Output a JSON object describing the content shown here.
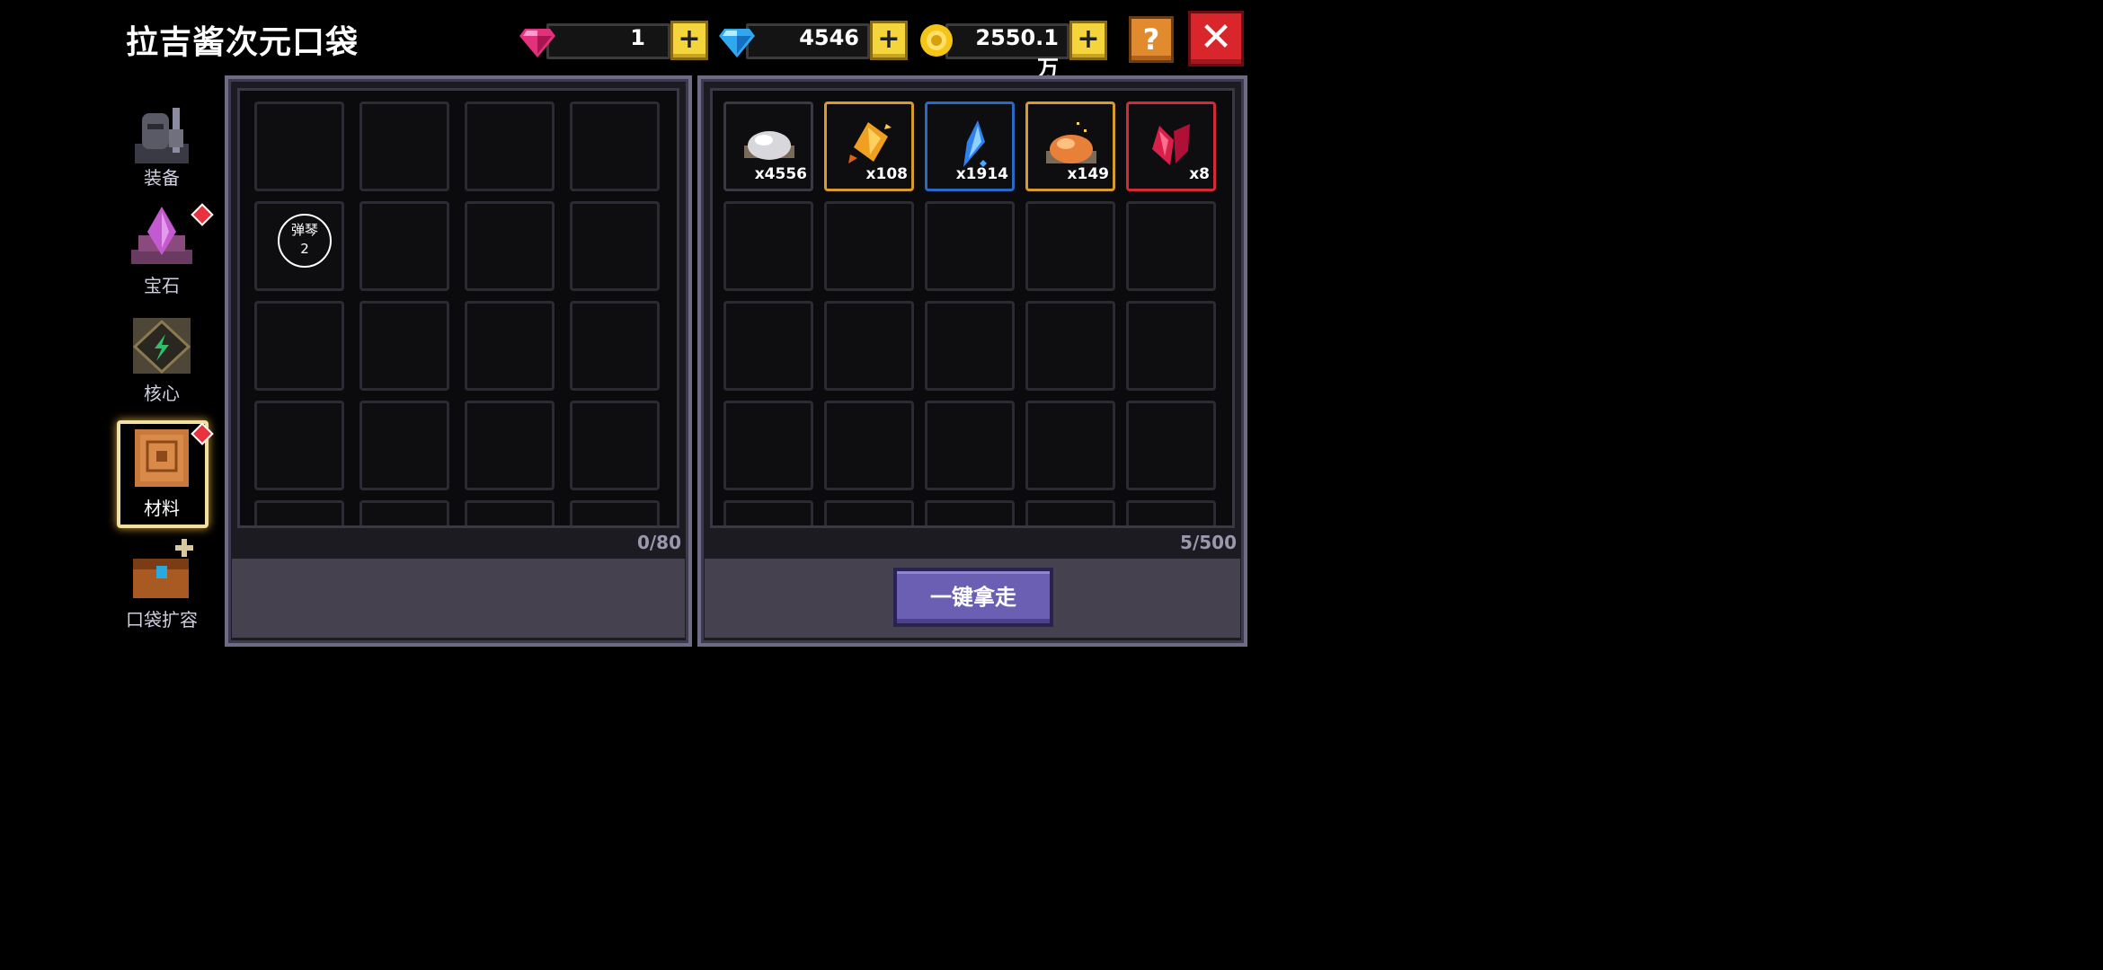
{
  "title": "拉吉酱次元口袋",
  "currencies": [
    {
      "name": "pink-gem-icon",
      "value": "1"
    },
    {
      "name": "blue-gem-icon",
      "value": "4546"
    },
    {
      "name": "gold-coin-icon",
      "value": "2550.1万"
    }
  ],
  "plus_label": "+",
  "help_label": "?",
  "close_label": "✕",
  "sidebar": [
    {
      "label": "装备",
      "badge": false
    },
    {
      "label": "宝石",
      "badge": true
    },
    {
      "label": "核心",
      "badge": false
    },
    {
      "label": "材料",
      "badge": true,
      "active": true
    },
    {
      "label": "口袋扩容",
      "badge": false
    }
  ],
  "left_panel": {
    "count": "0/80",
    "tooltip_line1": "弹琴",
    "tooltip_line2": "2"
  },
  "right_panel": {
    "count": "5/500",
    "items": [
      {
        "icon": "silver-dust-icon",
        "qty": "x4556",
        "border": "#3a3845"
      },
      {
        "icon": "gold-shard-icon",
        "qty": "x108",
        "border": "#d89a2a"
      },
      {
        "icon": "blue-crystal-icon",
        "qty": "x1914",
        "border": "#2a68c8"
      },
      {
        "icon": "orange-dust-icon",
        "qty": "x149",
        "border": "#d89a2a"
      },
      {
        "icon": "red-crystal-icon",
        "qty": "x8",
        "border": "#d22a36"
      }
    ],
    "take_all_label": "一键拿走"
  }
}
